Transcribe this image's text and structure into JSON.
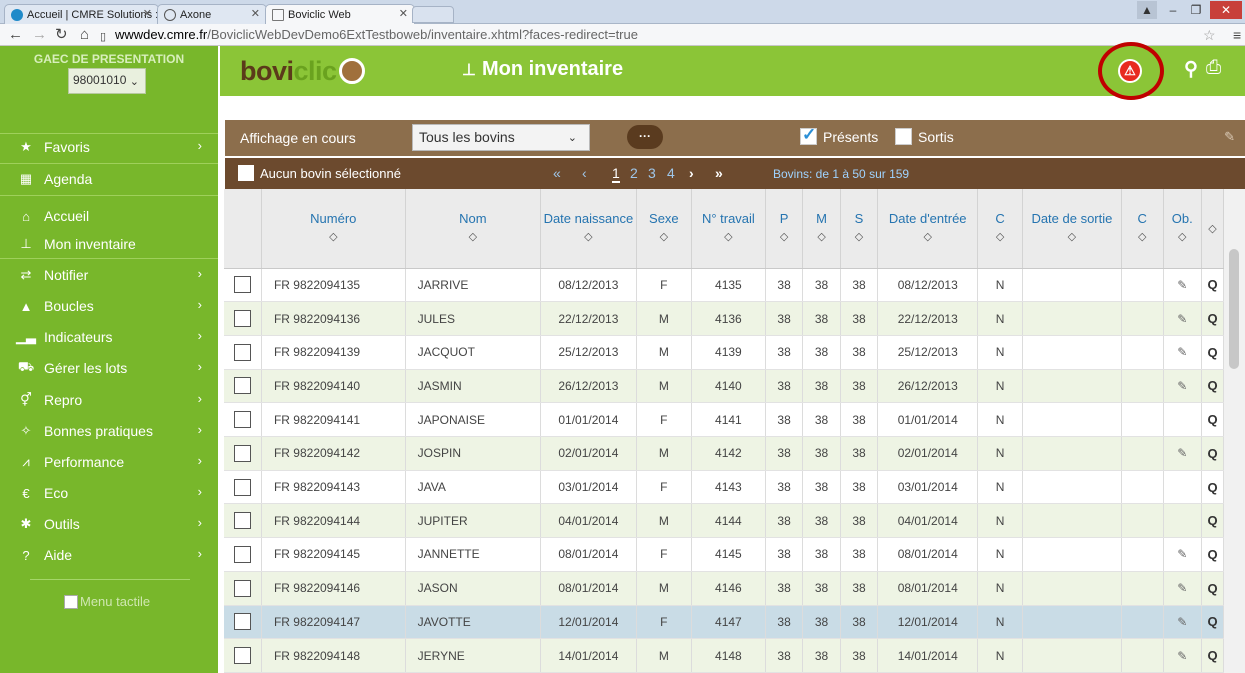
{
  "browser": {
    "tabs": [
      {
        "label": "Accueil | CMRE Solutions :",
        "active": false
      },
      {
        "label": "Axone",
        "active": false
      },
      {
        "label": "Boviclic Web",
        "active": true
      }
    ],
    "url_host": "wwwdev.cmre.fr",
    "url_path": "/BoviclicWebDevDemo6ExtTestboweb/inventaire.xhtml?faces-redirect=true"
  },
  "sidebar": {
    "farm_title": "GAEC DE PRESENTATION",
    "farm_id": "98001010",
    "items": [
      {
        "label": "Favoris",
        "icon": "star-icon",
        "arrow": true
      },
      {
        "label": "Agenda",
        "icon": "calendar-icon",
        "arrow": false
      },
      {
        "label": "Accueil",
        "icon": "home-icon",
        "arrow": false
      },
      {
        "label": "Mon inventaire",
        "icon": "sitemap-icon",
        "arrow": false
      },
      {
        "label": "Notifier",
        "icon": "exchange-icon",
        "arrow": true
      },
      {
        "label": "Boucles",
        "icon": "tag-icon",
        "arrow": true
      },
      {
        "label": "Indicateurs",
        "icon": "bar-chart-icon",
        "arrow": true
      },
      {
        "label": "Gérer les lots",
        "icon": "truck-icon",
        "arrow": true
      },
      {
        "label": "Repro",
        "icon": "gender-icon",
        "arrow": true
      },
      {
        "label": "Bonnes pratiques",
        "icon": "wand-icon",
        "arrow": true
      },
      {
        "label": "Performance",
        "icon": "line-chart-icon",
        "arrow": true
      },
      {
        "label": "Eco",
        "icon": "euro-icon",
        "arrow": true
      },
      {
        "label": "Outils",
        "icon": "cog-icon",
        "arrow": true
      },
      {
        "label": "Aide",
        "icon": "help-icon",
        "arrow": true
      }
    ],
    "menu_tactile": "Menu tactile"
  },
  "header": {
    "logo_a": "bovi",
    "logo_b": "clic",
    "page_title": "Mon inventaire",
    "alert_glyph": "⚠"
  },
  "filter": {
    "label": "Affichage en cours",
    "select_value": "Tous les bovins",
    "more_glyph": "···",
    "presents_label": "Présents",
    "presents_checked": true,
    "sortis_label": "Sortis",
    "sortis_checked": false
  },
  "pagination": {
    "none_selected": "Aucun bovin sélectionné",
    "first": "«",
    "prev": "‹",
    "pages": [
      "1",
      "2",
      "3",
      "4"
    ],
    "next": "›",
    "last": "»",
    "info": "Bovins: de 1 à 50 sur 159"
  },
  "table": {
    "columns": [
      "Numéro",
      "Nom",
      "Date naissance",
      "Sexe",
      "N° travail",
      "P",
      "M",
      "S",
      "Date d'entrée",
      "C",
      "Date de sortie",
      "C",
      "Ob."
    ],
    "sort_glyph": "◇",
    "rows": [
      {
        "numero": "FR 9822094135",
        "nom": "JARRIVE",
        "naissance": "08/12/2013",
        "sexe": "F",
        "travail": "4135",
        "p": "38",
        "m": "38",
        "s": "38",
        "entree": "08/12/2013",
        "c": "N",
        "sortie": "",
        "c2": "",
        "edit": true
      },
      {
        "numero": "FR 9822094136",
        "nom": "JULES",
        "naissance": "22/12/2013",
        "sexe": "M",
        "travail": "4136",
        "p": "38",
        "m": "38",
        "s": "38",
        "entree": "22/12/2013",
        "c": "N",
        "sortie": "",
        "c2": "",
        "edit": true
      },
      {
        "numero": "FR 9822094139",
        "nom": "JACQUOT",
        "naissance": "25/12/2013",
        "sexe": "M",
        "travail": "4139",
        "p": "38",
        "m": "38",
        "s": "38",
        "entree": "25/12/2013",
        "c": "N",
        "sortie": "",
        "c2": "",
        "edit": true
      },
      {
        "numero": "FR 9822094140",
        "nom": "JASMIN",
        "naissance": "26/12/2013",
        "sexe": "M",
        "travail": "4140",
        "p": "38",
        "m": "38",
        "s": "38",
        "entree": "26/12/2013",
        "c": "N",
        "sortie": "",
        "c2": "",
        "edit": true
      },
      {
        "numero": "FR 9822094141",
        "nom": "JAPONAISE",
        "naissance": "01/01/2014",
        "sexe": "F",
        "travail": "4141",
        "p": "38",
        "m": "38",
        "s": "38",
        "entree": "01/01/2014",
        "c": "N",
        "sortie": "",
        "c2": "",
        "edit": false
      },
      {
        "numero": "FR 9822094142",
        "nom": "JOSPIN",
        "naissance": "02/01/2014",
        "sexe": "M",
        "travail": "4142",
        "p": "38",
        "m": "38",
        "s": "38",
        "entree": "02/01/2014",
        "c": "N",
        "sortie": "",
        "c2": "",
        "edit": true
      },
      {
        "numero": "FR 9822094143",
        "nom": "JAVA",
        "naissance": "03/01/2014",
        "sexe": "F",
        "travail": "4143",
        "p": "38",
        "m": "38",
        "s": "38",
        "entree": "03/01/2014",
        "c": "N",
        "sortie": "",
        "c2": "",
        "edit": false
      },
      {
        "numero": "FR 9822094144",
        "nom": "JUPITER",
        "naissance": "04/01/2014",
        "sexe": "M",
        "travail": "4144",
        "p": "38",
        "m": "38",
        "s": "38",
        "entree": "04/01/2014",
        "c": "N",
        "sortie": "",
        "c2": "",
        "edit": false
      },
      {
        "numero": "FR 9822094145",
        "nom": "JANNETTE",
        "naissance": "08/01/2014",
        "sexe": "F",
        "travail": "4145",
        "p": "38",
        "m": "38",
        "s": "38",
        "entree": "08/01/2014",
        "c": "N",
        "sortie": "",
        "c2": "",
        "edit": true
      },
      {
        "numero": "FR 9822094146",
        "nom": "JASON",
        "naissance": "08/01/2014",
        "sexe": "M",
        "travail": "4146",
        "p": "38",
        "m": "38",
        "s": "38",
        "entree": "08/01/2014",
        "c": "N",
        "sortie": "",
        "c2": "",
        "edit": true
      },
      {
        "numero": "FR 9822094147",
        "nom": "JAVOTTE",
        "naissance": "12/01/2014",
        "sexe": "F",
        "travail": "4147",
        "p": "38",
        "m": "38",
        "s": "38",
        "entree": "12/01/2014",
        "c": "N",
        "sortie": "",
        "c2": "",
        "edit": true
      },
      {
        "numero": "FR 9822094148",
        "nom": "JERYNE",
        "naissance": "14/01/2014",
        "sexe": "M",
        "travail": "4148",
        "p": "38",
        "m": "38",
        "s": "38",
        "entree": "14/01/2014",
        "c": "N",
        "sortie": "",
        "c2": "",
        "edit": true
      }
    ]
  },
  "colors": {
    "sidebar_green": "#78b72b",
    "header_green": "#8bc537",
    "brown_bar": "#8c6e4c",
    "dark_brown_bar": "#6c4a2e",
    "alert_red": "#e82b1e"
  }
}
